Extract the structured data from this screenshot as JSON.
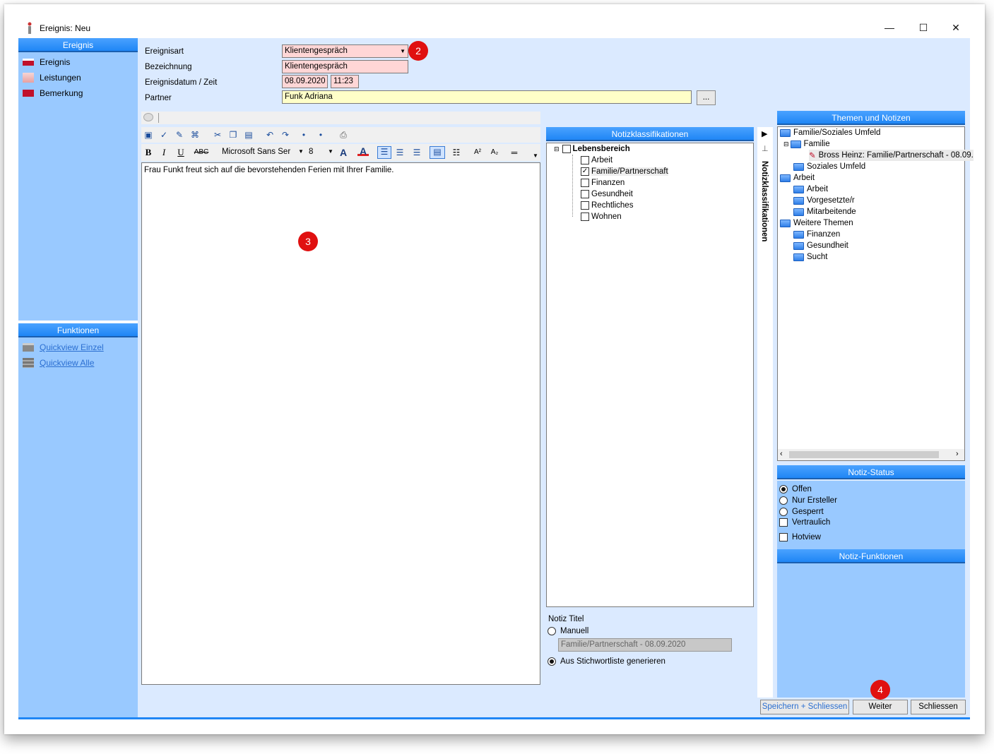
{
  "window": {
    "title": "Ereignis: Neu",
    "minimize": "—",
    "maximize": "☐",
    "close": "✕"
  },
  "sidebar": {
    "header": "Ereignis",
    "items": [
      {
        "label": "Ereignis",
        "icon": "ereignis-icon"
      },
      {
        "label": "Leistungen",
        "icon": "leistungen-icon"
      },
      {
        "label": "Bemerkung",
        "icon": "bemerkung-icon"
      }
    ],
    "functions_header": "Funktionen",
    "functions": [
      {
        "label": "Quickview Einzel",
        "icon": "quickview-einzel-icon"
      },
      {
        "label": "Quickview Alle",
        "icon": "quickview-alle-icon"
      }
    ]
  },
  "form": {
    "ereignisart_label": "Ereignisart",
    "ereignisart_value": "Klientengespräch",
    "bezeichnung_label": "Bezeichnung",
    "bezeichnung_value": "Klientengespräch",
    "datum_label": "Ereignisdatum / Zeit",
    "datum_value": "08.09.2020",
    "zeit_value": "11:23",
    "partner_label": "Partner",
    "partner_value": "Funk Adriana",
    "partner_browse": "..."
  },
  "badges": {
    "b2": "2",
    "b3": "3",
    "b4": "4"
  },
  "editor": {
    "font_name": "Microsoft Sans Ser",
    "font_size": "8",
    "text": "Frau Funkt freut sich auf die bevorstehenden Ferien mit Ihrer Familie."
  },
  "notiz": {
    "header": "Notizklassifikationen",
    "vertical_tab": "Notizklassifikationen",
    "root": "Lebensbereich",
    "items": [
      {
        "label": "Arbeit",
        "checked": false
      },
      {
        "label": "Familie/Partnerschaft",
        "checked": true
      },
      {
        "label": "Finanzen",
        "checked": false
      },
      {
        "label": "Gesundheit",
        "checked": false
      },
      {
        "label": "Rechtliches",
        "checked": false
      },
      {
        "label": "Wohnen",
        "checked": false
      }
    ],
    "titel_label": "Notiz Titel",
    "manuell_label": "Manuell",
    "manuell_value": "Familie/Partnerschaft - 08.09.2020",
    "generieren_label": "Aus Stichwortliste generieren"
  },
  "themen": {
    "header": "Themen und Notizen",
    "tree": [
      {
        "label": "Familie/Soziales Umfeld",
        "level": 0
      },
      {
        "label": "Familie",
        "level": 1
      },
      {
        "label": "Bross Heinz: Familie/Partnerschaft - 08.09.",
        "level": 2
      },
      {
        "label": "Soziales Umfeld",
        "level": 1
      },
      {
        "label": "Arbeit",
        "level": 0
      },
      {
        "label": "Arbeit",
        "level": 1
      },
      {
        "label": "Vorgesetzte/r",
        "level": 1
      },
      {
        "label": "Mitarbeitende",
        "level": 1
      },
      {
        "label": "Weitere Themen",
        "level": 0
      },
      {
        "label": "Finanzen",
        "level": 1
      },
      {
        "label": "Gesundheit",
        "level": 1
      },
      {
        "label": "Sucht",
        "level": 1
      }
    ]
  },
  "status": {
    "header": "Notiz-Status",
    "offen": "Offen",
    "nur_ersteller": "Nur Ersteller",
    "gesperrt": "Gesperrt",
    "vertraulich": "Vertraulich",
    "hotview": "Hotview",
    "funktionen_header": "Notiz-Funktionen"
  },
  "buttons": {
    "speichern": "Speichern + Schliessen",
    "weiter": "Weiter",
    "schliessen": "Schliessen"
  }
}
